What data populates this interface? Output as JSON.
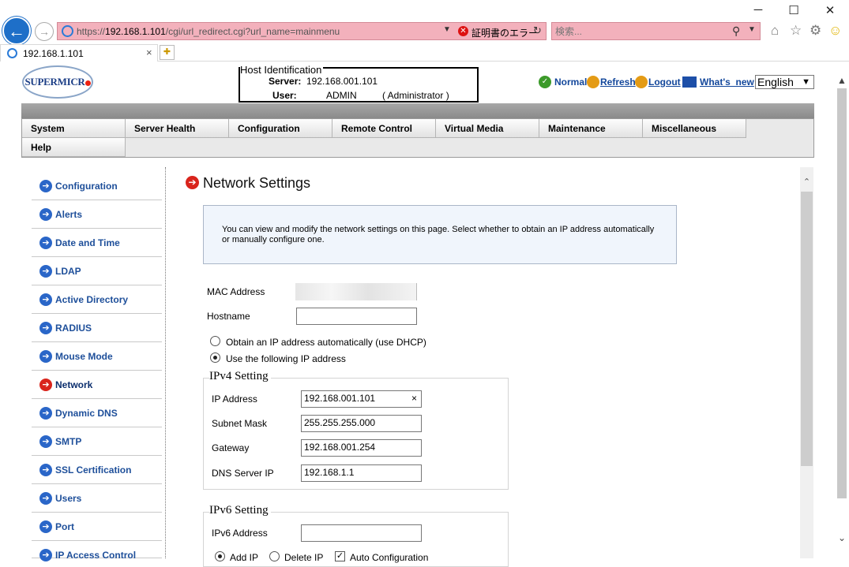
{
  "browser": {
    "url_prefix": "https://",
    "url_host": "192.168.1.101",
    "url_path": "/cgi/url_redirect.cgi?url_name=mainmenu",
    "cert_error": "証明書のエラー",
    "search_placeholder": "検索...",
    "tab_title": "192.168.1.101"
  },
  "header": {
    "logo_text": "SUPERMICR",
    "host_legend": "Host Identification",
    "server_label": "Server:",
    "server_value": "192.168.001.101",
    "user_label": "User:",
    "user_value": "ADMIN",
    "user_role": "( Administrator )",
    "links": {
      "normal": "Normal",
      "refresh": "Refresh",
      "logout": "Logout",
      "whats_new": "What's_new"
    },
    "language": "English"
  },
  "menu": [
    "System",
    "Server Health",
    "Configuration",
    "Remote Control",
    "Virtual Media",
    "Maintenance",
    "Miscellaneous",
    "Help"
  ],
  "sidebar": [
    {
      "label": "Configuration"
    },
    {
      "label": "Alerts"
    },
    {
      "label": "Date and Time"
    },
    {
      "label": "LDAP"
    },
    {
      "label": "Active Directory"
    },
    {
      "label": "RADIUS"
    },
    {
      "label": "Mouse Mode"
    },
    {
      "label": "Network"
    },
    {
      "label": "Dynamic DNS"
    },
    {
      "label": "SMTP"
    },
    {
      "label": "SSL Certification"
    },
    {
      "label": "Users"
    },
    {
      "label": "Port"
    },
    {
      "label": "IP Access Control"
    }
  ],
  "main": {
    "title": "Network Settings",
    "info": "You can view and modify the network settings on this page. Select whether to obtain an IP address automatically or manually configure one.",
    "mac_label": "MAC Address",
    "hostname_label": "Hostname",
    "hostname_value": "",
    "dhcp_label": "Obtain an IP address automatically (use DHCP)",
    "static_label": "Use the following IP address",
    "ipv4_legend": "IPv4 Setting",
    "ip_label": "IP Address",
    "ip_value": "192.168.001.101",
    "ip_clear": "×",
    "mask_label": "Subnet Mask",
    "mask_value": "255.255.255.000",
    "gw_label": "Gateway",
    "gw_value": "192.168.001.254",
    "dns_label": "DNS Server IP",
    "dns_value": "192.168.1.1",
    "ipv6_legend": "IPv6 Setting",
    "ipv6_label": "IPv6 Address",
    "ipv6_value": "",
    "add_ip": "Add IP",
    "delete_ip": "Delete IP",
    "auto_config": "Auto Configuration"
  }
}
